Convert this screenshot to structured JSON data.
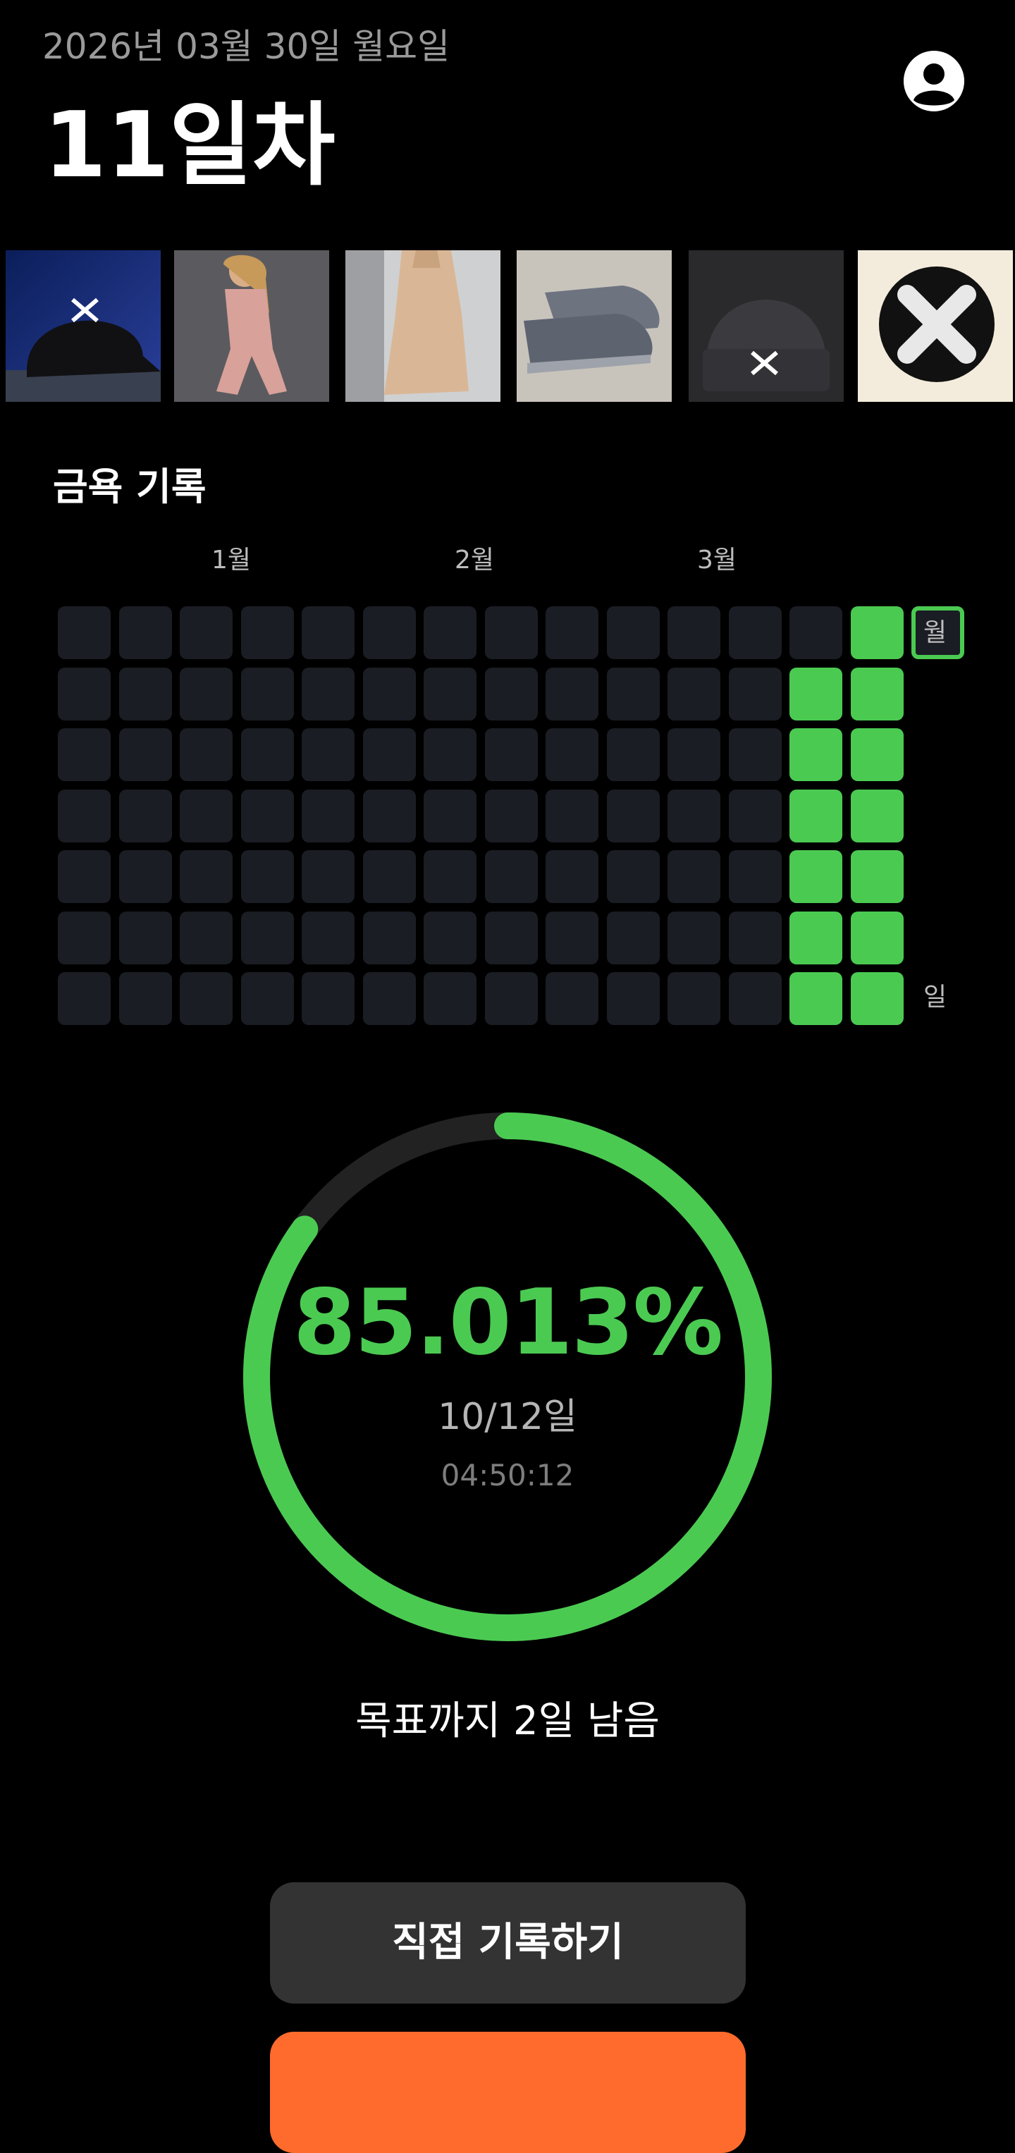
{
  "header": {
    "date": "2026년 03월 30일 월요일",
    "day_count": "11일차",
    "profile_icon": "user-avatar-icon"
  },
  "products": [
    {
      "name": "black cap with x logo"
    },
    {
      "name": "pink knit lounge set"
    },
    {
      "name": "beige ribbed mini dress"
    },
    {
      "name": "grey knit sneakers"
    },
    {
      "name": "black beanie with x logo"
    },
    {
      "name": "x logo round badge"
    }
  ],
  "record": {
    "title": "금욕 기록",
    "months": [
      "1월",
      "2월",
      "3월"
    ],
    "weekday_top": "월",
    "weekday_bottom": "일",
    "weeks": 14,
    "days_per_week": 7,
    "filled_days": 11,
    "today_marker": "column 14, row 1",
    "colors": {
      "empty": "#1a1d23",
      "filled": "#4bca52",
      "today_border": "#4bca52"
    }
  },
  "progress": {
    "percent_label": "85.013%",
    "percent_value": 85.013,
    "fraction": "10/12일",
    "timer": "04:50:12",
    "track_color": "#222222",
    "fill_color": "#4bca52"
  },
  "remaining": "목표까지 2일 남음",
  "buttons": {
    "manual_record": "직접 기록하기"
  },
  "colors": {
    "background": "#000000",
    "accent_green": "#4bca52",
    "accent_orange": "#ff6b2c"
  }
}
